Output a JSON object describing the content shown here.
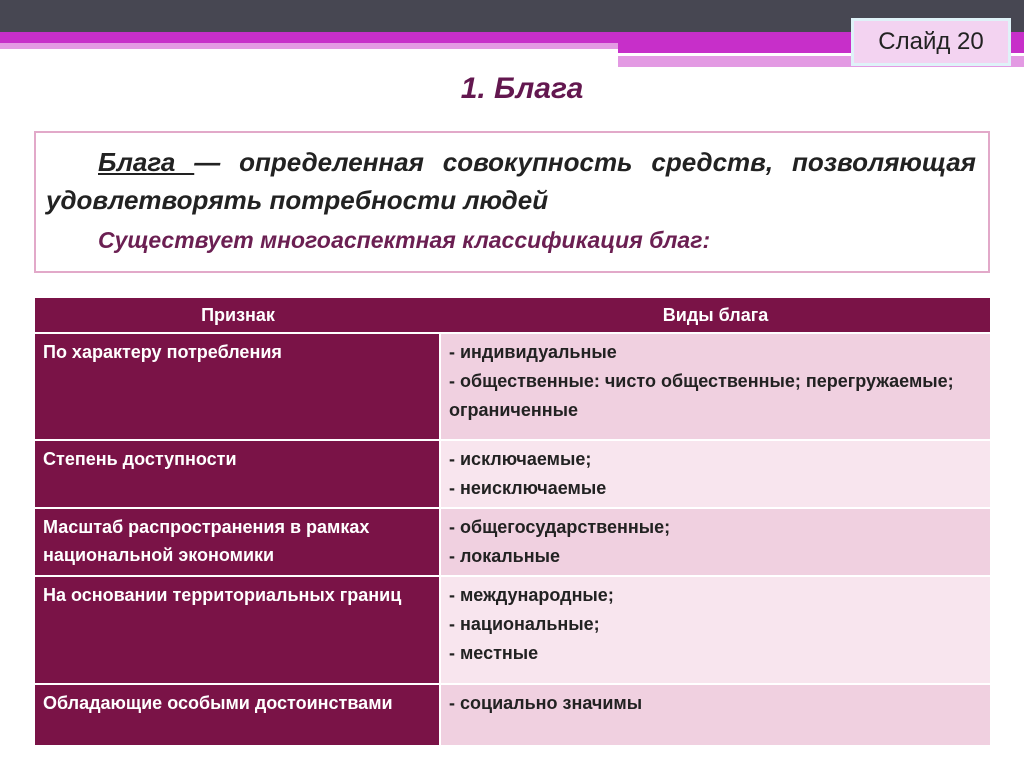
{
  "slide_label": "Слайд 20",
  "title": "1. Блага",
  "definition": {
    "term": "Блага ",
    "text": "— определенная совокупность средств, позволяющая удовлетворять потребности людей",
    "classification": "Существует многоаспектная классификация благ:"
  },
  "table": {
    "headers": [
      "Признак",
      "Виды блага"
    ],
    "rows": [
      {
        "key": "По характеру потребления",
        "values": [
          "-  индивидуальные",
          "-  общественные: чисто общественные; перегружаемые; ограниченные"
        ]
      },
      {
        "key": "Степень доступности",
        "values": [
          "-  исключаемые;",
          "- неисключаемые"
        ]
      },
      {
        "key": "Масштаб распространения в рамках национальной экономики",
        "values": [
          "- общегосударственные;",
          "- локальные"
        ]
      },
      {
        "key": "На основании территориальных границ",
        "values": [
          "- международные;",
          "- национальные;",
          "- местные"
        ]
      },
      {
        "key": "Обладающие особыми достоинствами",
        "values": [
          "- социально  значимы"
        ]
      }
    ]
  }
}
